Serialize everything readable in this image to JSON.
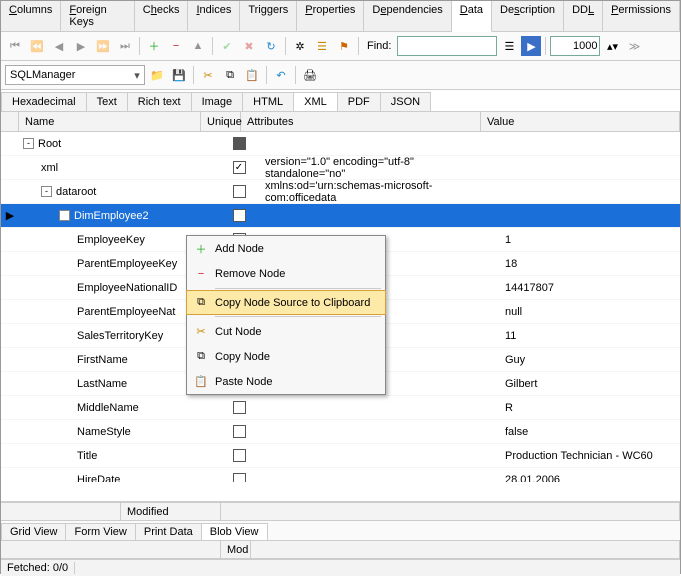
{
  "main_tabs": {
    "columns": "Columns",
    "fk": "Foreign Keys",
    "checks": "Checks",
    "indices": "Indices",
    "triggers": "Triggers",
    "properties": "Properties",
    "dependencies": "Dependencies",
    "data": "Data",
    "description": "Description",
    "ddl": "DDL",
    "permissions": "Permissions"
  },
  "toolbar": {
    "find_label": "Find:",
    "find_value": "",
    "limit_value": "1000"
  },
  "combo": {
    "value": "SQLManager"
  },
  "sub_tabs": {
    "hex": "Hexadecimal",
    "text": "Text",
    "rich": "Rich text",
    "image": "Image",
    "html": "HTML",
    "xml": "XML",
    "pdf": "PDF",
    "json": "JSON"
  },
  "grid": {
    "headers": {
      "name": "Name",
      "unique": "Unique",
      "attributes": "Attributes",
      "value": "Value"
    },
    "rows": [
      {
        "name": "Root",
        "indent": 0,
        "expand": "-",
        "unique": "filled",
        "attr": "",
        "value": ""
      },
      {
        "name": "xml",
        "indent": 1,
        "expand": "",
        "unique": "checked",
        "attr": "version=\"1.0\" encoding=\"utf-8\" standalone=\"no\"",
        "value": ""
      },
      {
        "name": "dataroot",
        "indent": 1,
        "expand": "-",
        "unique": "",
        "attr": "xmlns:od='urn:schemas-microsoft-com:officedata",
        "value": ""
      },
      {
        "name": "DimEmployee2",
        "indent": 2,
        "expand": "-",
        "unique": "",
        "attr": "",
        "value": "",
        "selected": true
      },
      {
        "name": "EmployeeKey",
        "indent": 3,
        "expand": "",
        "unique": "",
        "attr": "",
        "value": "1"
      },
      {
        "name": "ParentEmployeeKey",
        "indent": 3,
        "expand": "",
        "unique": "",
        "attr": "",
        "value": "18"
      },
      {
        "name": "EmployeeNationalID",
        "indent": 3,
        "expand": "",
        "unique": "",
        "attr": "",
        "value": "14417807"
      },
      {
        "name": "ParentEmployeeNat",
        "indent": 3,
        "expand": "",
        "unique": "",
        "attr": "",
        "value": "null"
      },
      {
        "name": "SalesTerritoryKey",
        "indent": 3,
        "expand": "",
        "unique": "",
        "attr": "",
        "value": "11"
      },
      {
        "name": "FirstName",
        "indent": 3,
        "expand": "",
        "unique": "",
        "attr": "",
        "value": "Guy"
      },
      {
        "name": "LastName",
        "indent": 3,
        "expand": "",
        "unique": "",
        "attr": "",
        "value": "Gilbert"
      },
      {
        "name": "MiddleName",
        "indent": 3,
        "expand": "",
        "unique": "",
        "attr": "",
        "value": "R"
      },
      {
        "name": "NameStyle",
        "indent": 3,
        "expand": "",
        "unique": "",
        "attr": "",
        "value": "false"
      },
      {
        "name": "Title",
        "indent": 3,
        "expand": "",
        "unique": "",
        "attr": "",
        "value": "Production Technician - WC60"
      },
      {
        "name": "HireDate",
        "indent": 3,
        "expand": "",
        "unique": "",
        "attr": "",
        "value": "28.01.2006"
      }
    ]
  },
  "context_menu": {
    "add": "Add Node",
    "remove": "Remove Node",
    "copy_source": "Copy Node Source to Clipboard",
    "cut": "Cut Node",
    "copy": "Copy Node",
    "paste": "Paste Node"
  },
  "status": {
    "modified": "Modified",
    "mod2": "Mod"
  },
  "bottom_tabs": {
    "grid": "Grid View",
    "form": "Form View",
    "print": "Print Data",
    "blob": "Blob View"
  },
  "fetched": {
    "label": "Fetched: 0/0"
  }
}
